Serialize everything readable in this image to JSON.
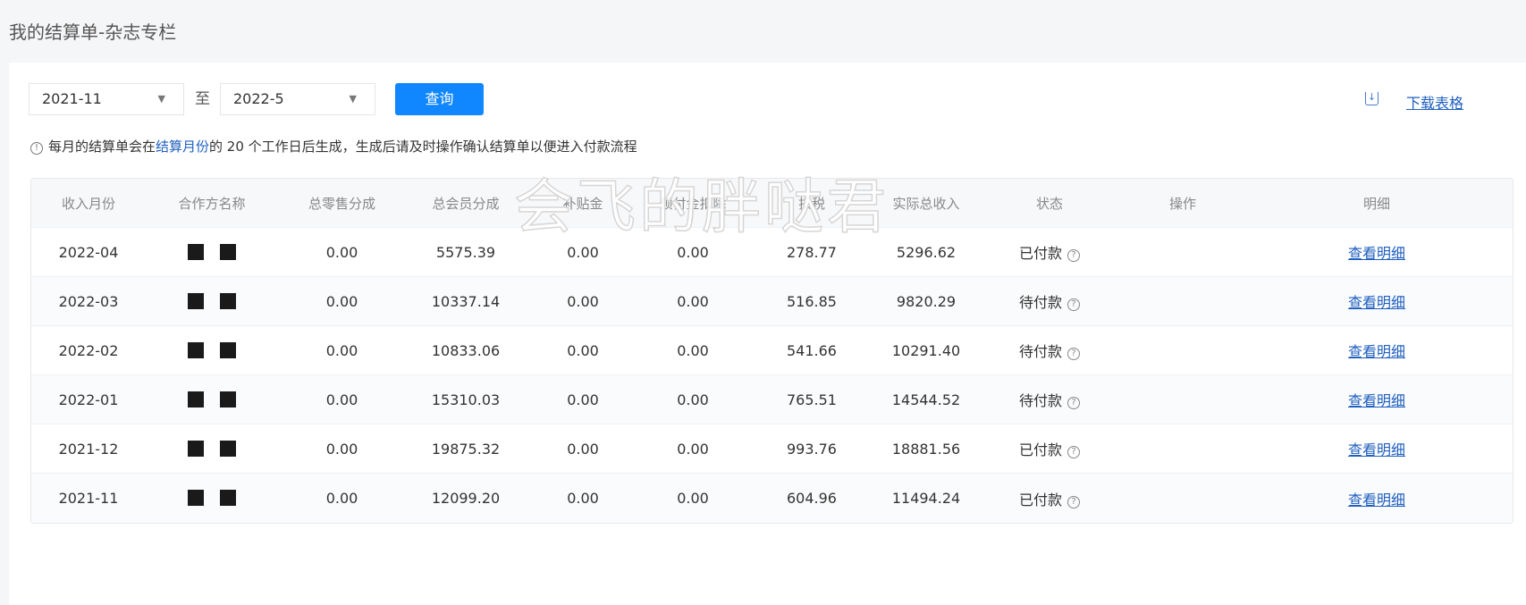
{
  "page_title": "我的结算单-杂志专栏",
  "filters": {
    "start": "2021-11",
    "separator": "至",
    "end": "2022-5",
    "query_label": "查询",
    "download_label": "下载表格"
  },
  "notice": {
    "pre": "每月的结算单会在",
    "link": "结算月份",
    "post": "的 20 个工作日后生成，生成后请及时操作确认结算单以便进入付款流程"
  },
  "watermark": "会飞的胖哒君",
  "table": {
    "headers": [
      "收入月份",
      "合作方名称",
      "总零售分成",
      "总会员分成",
      "补贴金",
      "预付金扣除",
      "扣税",
      "实际总收入",
      "状态",
      "操作",
      "明细"
    ],
    "rows": [
      {
        "month": "2022-04",
        "retail": "0.00",
        "member": "5575.39",
        "subsidy": "0.00",
        "prepay": "0.00",
        "tax": "278.77",
        "income": "5296.62",
        "status": "已付款",
        "detail": "查看明细"
      },
      {
        "month": "2022-03",
        "retail": "0.00",
        "member": "10337.14",
        "subsidy": "0.00",
        "prepay": "0.00",
        "tax": "516.85",
        "income": "9820.29",
        "status": "待付款",
        "detail": "查看明细"
      },
      {
        "month": "2022-02",
        "retail": "0.00",
        "member": "10833.06",
        "subsidy": "0.00",
        "prepay": "0.00",
        "tax": "541.66",
        "income": "10291.40",
        "status": "待付款",
        "detail": "查看明细"
      },
      {
        "month": "2022-01",
        "retail": "0.00",
        "member": "15310.03",
        "subsidy": "0.00",
        "prepay": "0.00",
        "tax": "765.51",
        "income": "14544.52",
        "status": "待付款",
        "detail": "查看明细"
      },
      {
        "month": "2021-12",
        "retail": "0.00",
        "member": "19875.32",
        "subsidy": "0.00",
        "prepay": "0.00",
        "tax": "993.76",
        "income": "18881.56",
        "status": "已付款",
        "detail": "查看明细"
      },
      {
        "month": "2021-11",
        "retail": "0.00",
        "member": "12099.20",
        "subsidy": "0.00",
        "prepay": "0.00",
        "tax": "604.96",
        "income": "11494.24",
        "status": "已付款",
        "detail": "查看明细"
      }
    ]
  },
  "colors": {
    "accent": "#1187ff",
    "link": "#1f5fbf"
  }
}
